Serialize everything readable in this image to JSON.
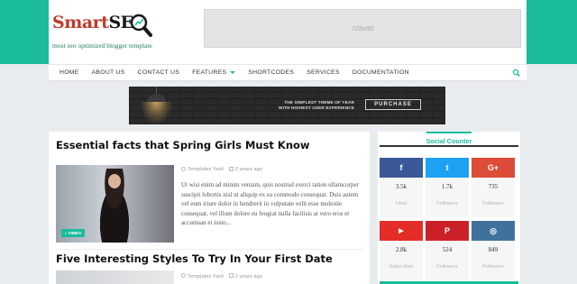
{
  "brand": {
    "name_part1": "Smart",
    "name_part2": "SE",
    "tagline": "most seo optimized blogger template",
    "accent": "#1abc9c",
    "logo_red": "#c0392b"
  },
  "ad_top": {
    "label": "728x90"
  },
  "nav": {
    "items": [
      "HOME",
      "ABOUT US",
      "CONTACT US",
      "FEATURES",
      "SHORTCODES",
      "SERVICES",
      "DOCUMENTATION"
    ],
    "dropdown_item_index": 3,
    "search_icon": "search-icon"
  },
  "banner": {
    "tagline_line1": "THE SIMPLEST THEME OF YEAR",
    "tagline_line2": "WITH HIGHEST USER EXPERIENCE",
    "button_label": "PURCHASE"
  },
  "posts": [
    {
      "title": "Essential facts that Spring Girls Must Know",
      "author": "Templates Yard",
      "time": "2 years ago",
      "badge": "VIMEO",
      "excerpt": "Ut wisi enim ad minim veniam, quis nostrud exerci tation ullamcorper suscipit lobortis nisl ut aliquip ex ea commodo consequat. Duis autem vel eum iriure dolor in hendrerit in vulputate velit esse molestie consequat, vel illum dolore eu feugiat nulla facilisis at vero eros et accumsan et iusto..."
    },
    {
      "title": "Five Interesting Styles To Try In Your First Date",
      "author": "Templates Yard",
      "time": "2 years ago"
    }
  ],
  "sidebar": {
    "title": "Social Counter",
    "counters": [
      {
        "icon": "facebook-icon",
        "glyph": "f",
        "color": "#3b5998",
        "count": "3.5k",
        "label": "Likes"
      },
      {
        "icon": "twitter-icon",
        "glyph": "t",
        "color": "#1da1f2",
        "count": "1.7k",
        "label": "Followers"
      },
      {
        "icon": "google-plus-icon",
        "glyph": "G+",
        "color": "#dd4b39",
        "count": "735",
        "label": "Followers"
      },
      {
        "icon": "youtube-icon",
        "glyph": "▶",
        "color": "#e52d27",
        "count": "2.8k",
        "label": "Subscribes"
      },
      {
        "icon": "pinterest-icon",
        "glyph": "P",
        "color": "#cb2027",
        "count": "524",
        "label": "Followers"
      },
      {
        "icon": "instagram-icon",
        "glyph": "◎",
        "color": "#3f729b",
        "count": "849",
        "label": "Followers"
      }
    ]
  }
}
